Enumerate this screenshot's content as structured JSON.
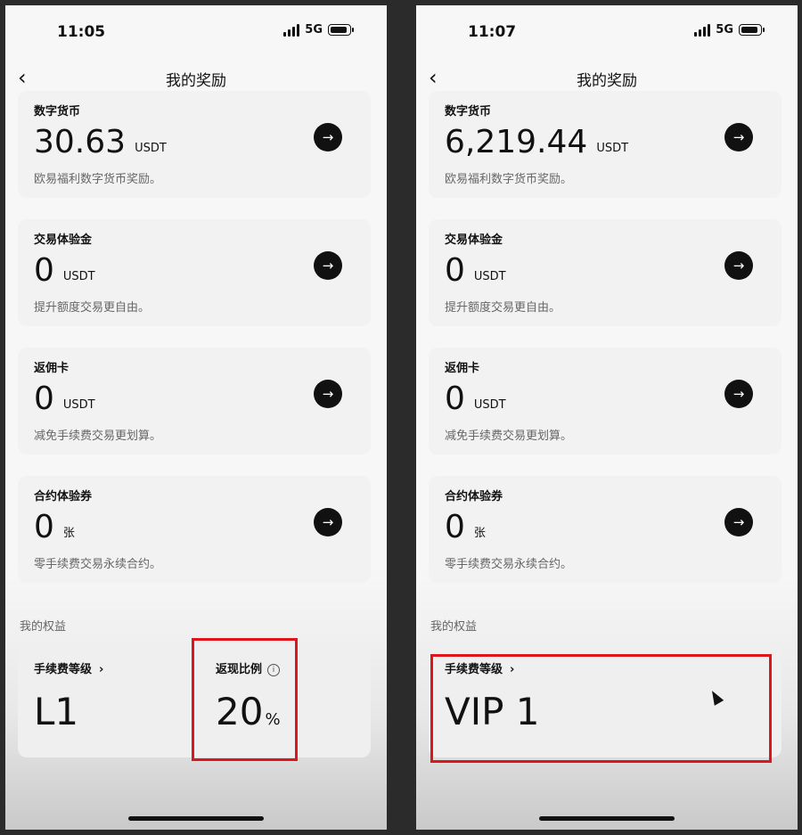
{
  "screens": [
    {
      "status": {
        "time": "11:05",
        "network": "5G"
      },
      "nav": {
        "title": "我的奖励"
      },
      "cards": [
        {
          "title": "数字货币",
          "value": "30.63",
          "unit": "USDT",
          "desc": "欧易福利数字货币奖励。"
        },
        {
          "title": "交易体验金",
          "value": "0",
          "unit": "USDT",
          "desc": "提升额度交易更自由。"
        },
        {
          "title": "返佣卡",
          "value": "0",
          "unit": "USDT",
          "desc": "减免手续费交易更划算。"
        },
        {
          "title": "合约体验券",
          "value": "0",
          "unit": "张",
          "desc": "零手续费交易永续合约。"
        }
      ],
      "benefits": {
        "section_label": "我的权益",
        "fee_level_label": "手续费等级",
        "fee_level_value": "L1",
        "cashback_label": "返现比例",
        "cashback_value": "20",
        "cashback_unit": "%"
      }
    },
    {
      "status": {
        "time": "11:07",
        "network": "5G"
      },
      "nav": {
        "title": "我的奖励"
      },
      "cards": [
        {
          "title": "数字货币",
          "value": "6,219.44",
          "unit": "USDT",
          "desc": "欧易福利数字货币奖励。"
        },
        {
          "title": "交易体验金",
          "value": "0",
          "unit": "USDT",
          "desc": "提升额度交易更自由。"
        },
        {
          "title": "返佣卡",
          "value": "0",
          "unit": "USDT",
          "desc": "减免手续费交易更划算。"
        },
        {
          "title": "合约体验券",
          "value": "0",
          "unit": "张",
          "desc": "零手续费交易永续合约。"
        }
      ],
      "benefits": {
        "section_label": "我的权益",
        "fee_level_label": "手续费等级",
        "fee_level_value": "VIP 1"
      }
    }
  ],
  "icons": {
    "back": "chevron-left-icon",
    "card_action": "arrow-right-icon",
    "fee_level_link": "chevron-right-icon",
    "cashback_info": "info-icon"
  },
  "colors": {
    "highlight": "#e0141b",
    "button": "#111111",
    "card": "#f2f2f2"
  }
}
